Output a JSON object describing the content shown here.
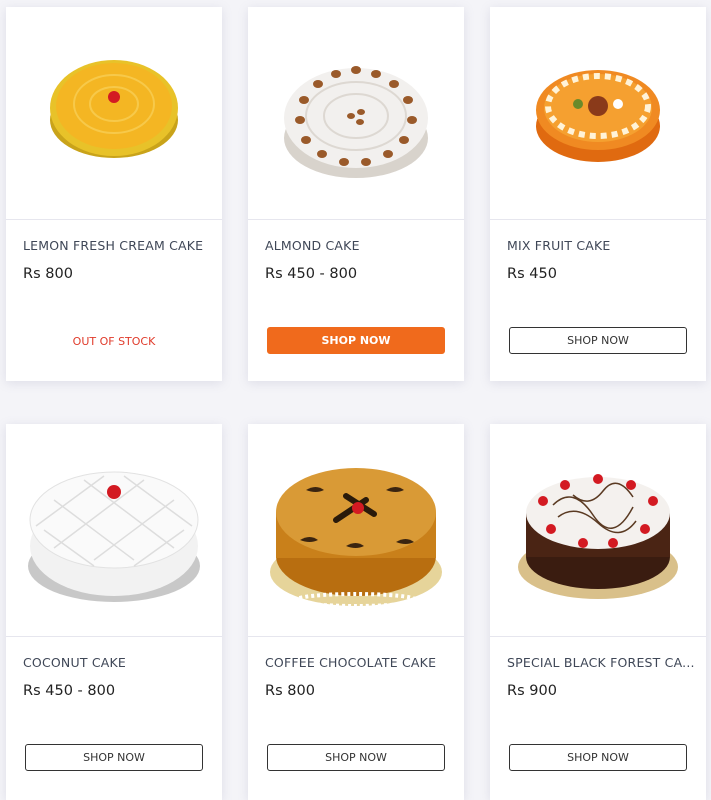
{
  "products": [
    {
      "name": "LEMON FRESH CREAM CAKE",
      "price": "Rs 800",
      "action": "OUT OF STOCK"
    },
    {
      "name": "ALMOND CAKE",
      "price": "Rs 450 - 800",
      "action": "SHOP NOW"
    },
    {
      "name": "MIX FRUIT CAKE",
      "price": "Rs 450",
      "action": "SHOP NOW"
    },
    {
      "name": "COCONUT CAKE",
      "price": "Rs 450 - 800",
      "action": "SHOP NOW"
    },
    {
      "name": "COFFEE CHOCOLATE CAKE",
      "price": "Rs 800",
      "action": "SHOP NOW"
    },
    {
      "name": "SPECIAL BLACK FOREST CA...",
      "price": "Rs 900",
      "action": "SHOP NOW"
    }
  ],
  "colors": {
    "accent": "#f06a1c",
    "out_of_stock": "#e03b2b"
  }
}
